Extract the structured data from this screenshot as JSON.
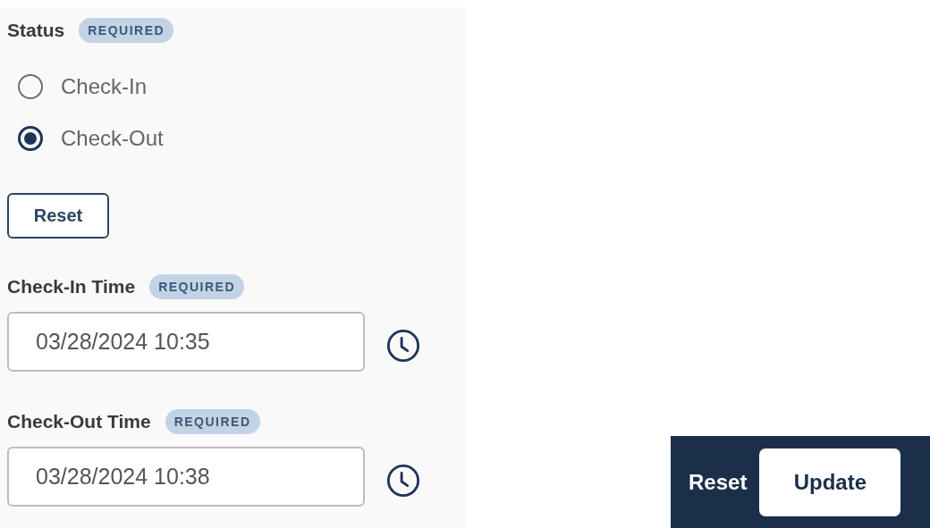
{
  "status": {
    "label": "Status",
    "badge": "REQUIRED",
    "options": [
      {
        "label": "Check-In",
        "selected": false
      },
      {
        "label": "Check-Out",
        "selected": true
      }
    ],
    "reset_button": "Reset"
  },
  "time_fields": [
    {
      "label": "Check-In Time",
      "badge": "REQUIRED",
      "value": "03/28/2024 10:35"
    },
    {
      "label": "Check-Out Time",
      "badge": "REQUIRED",
      "value": "03/28/2024 10:38"
    }
  ],
  "footer": {
    "buttons": [
      {
        "label": "Reset",
        "kind": "text"
      },
      {
        "label": "Update",
        "kind": "primary"
      }
    ]
  }
}
